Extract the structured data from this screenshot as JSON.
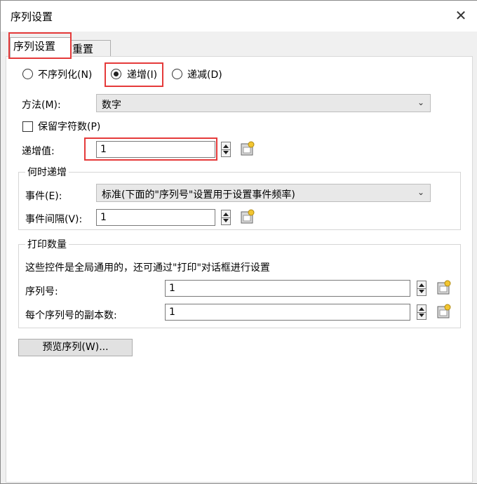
{
  "window": {
    "title": "序列设置",
    "close_symbol": "✕"
  },
  "tabs": [
    {
      "label": "序列设置",
      "selected": true
    },
    {
      "label": "重置",
      "selected": false
    }
  ],
  "mode": {
    "options": [
      {
        "label": "不序列化(N)",
        "checked": false
      },
      {
        "label": "递增(I)",
        "checked": true
      },
      {
        "label": "递减(D)",
        "checked": false
      }
    ]
  },
  "method": {
    "label": "方法(M):",
    "value": "数字"
  },
  "keep_chars": {
    "label": "保留字符数(P)",
    "checked": false
  },
  "increment": {
    "label": "递增值:",
    "value": "1"
  },
  "when_group": {
    "title": "何时递增",
    "event_label": "事件(E):",
    "event_value": "标准(下面的\"序列号\"设置用于设置事件频率)",
    "interval_label": "事件间隔(V):",
    "interval_value": "1"
  },
  "print_group": {
    "title": "打印数量",
    "note": "这些控件是全局通用的，还可通过\"打印\"对话框进行设置",
    "serial_label": "序列号:",
    "serial_value": "1",
    "copies_label": "每个序列号的副本数:",
    "copies_value": "1"
  },
  "preview_button": "预览序列(W)...",
  "icons": [
    "close-icon",
    "spin-icon",
    "data-source-wizard-icon",
    "chevron-down-icon"
  ],
  "colors": {
    "highlight_box": "#e53a3a"
  }
}
